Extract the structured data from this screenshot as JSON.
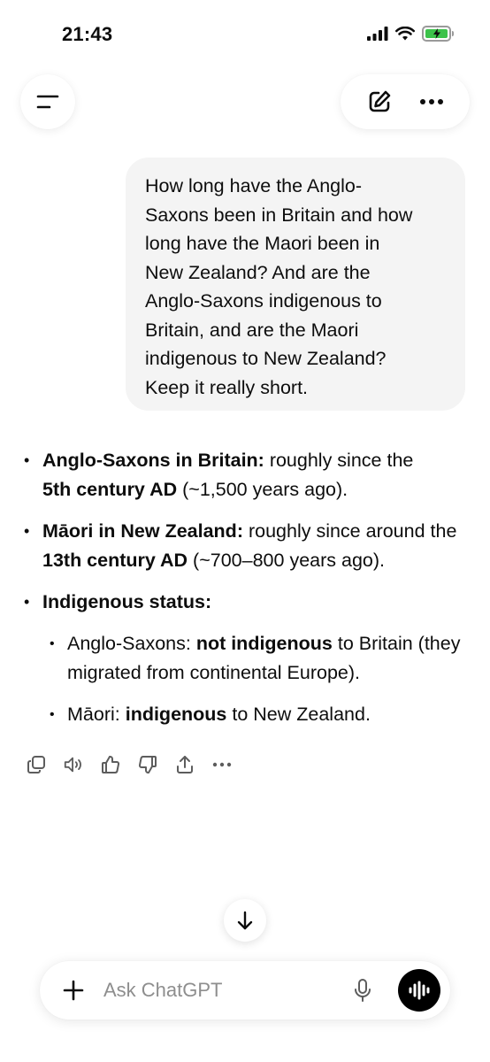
{
  "status_bar": {
    "time": "21:43",
    "icons": [
      "cellular-signal-icon",
      "wifi-icon",
      "battery-charging-icon"
    ],
    "battery_color": "#3cc24a"
  },
  "top_bar": {
    "left_icon": "menu-icon",
    "right_icons": [
      "new-chat-icon",
      "more-icon"
    ]
  },
  "user_message": {
    "lines": [
      "How long have the Anglo-",
      "Saxons been in Britain and how",
      "long have the Maori been in",
      "New Zealand? And are the",
      "Anglo-Saxons indigenous to",
      "Britain, and are the Maori",
      "indigenous to New Zealand?",
      "Keep it really short."
    ]
  },
  "answer": {
    "item1": {
      "bold": "Anglo-Saxons in Britain:",
      "text1": " roughly since the ",
      "bold2": "5th century AD",
      "text2": " (~1,500 years ago)."
    },
    "item2": {
      "bold": "Māori in New Zealand:",
      "text1": " roughly since around the ",
      "bold2": "13th century AD",
      "text2": " (~700–800 years ago)."
    },
    "item3": {
      "bold": "Indigenous status:",
      "sub1": {
        "text1": "Anglo-Saxons: ",
        "bold": "not indigenous",
        "text2": " to Britain (they migrated from continental Europe)."
      },
      "sub2": {
        "text1": "Māori: ",
        "bold": "indigenous",
        "text2": " to New Zealand."
      }
    }
  },
  "action_row": {
    "icons": [
      "copy-icon",
      "read-aloud-icon",
      "thumbs-up-icon",
      "thumbs-down-icon",
      "share-icon",
      "more-icon"
    ]
  },
  "composer": {
    "placeholder": "Ask ChatGPT",
    "icons": [
      "plus-icon",
      "microphone-icon",
      "voice-mode-icon"
    ]
  },
  "colors": {
    "bubble_bg": "#f4f4f4",
    "text": "#0d0d0d",
    "placeholder": "#8e8e8e"
  }
}
